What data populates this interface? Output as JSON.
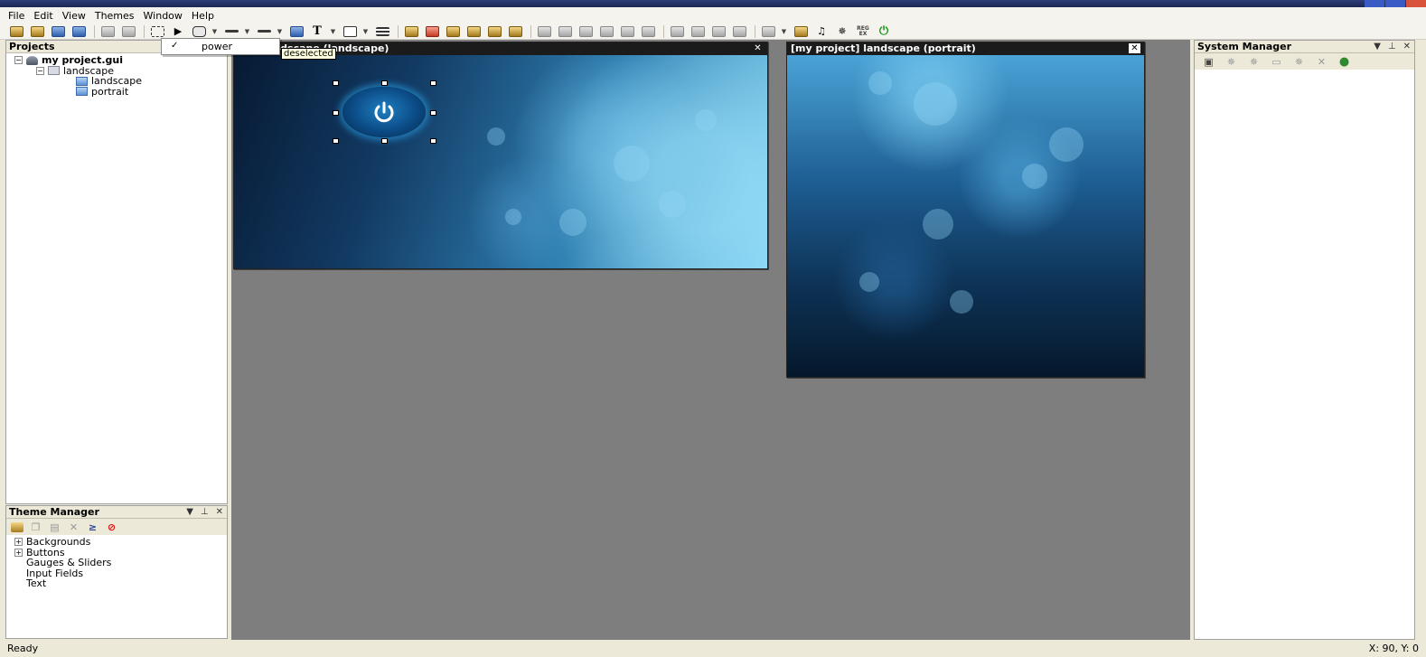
{
  "menu": [
    "File",
    "Edit",
    "View",
    "Themes",
    "Window",
    "Help"
  ],
  "toolbar_icons": [
    "open-project-icon",
    "open-icon",
    "save-icon",
    "save-all-icon",
    "properties-icon",
    "page-icon",
    "marquee-select-icon",
    "pointer-icon",
    "button-tool-icon",
    "slider-tool-icon",
    "input-tool-icon",
    "image-tool-icon",
    "text-tool-icon",
    "image-button-tool-icon",
    "list-tool-icon",
    "anim-d-icon",
    "anim-a-icon",
    "anim-s-icon",
    "anim-txt-icon",
    "anim-theme-icon",
    "anim-img-icon",
    "align-left-icon",
    "align-center-icon",
    "align-right-icon",
    "align-top-icon",
    "align-middle-icon",
    "align-bottom-icon",
    "same-width-icon",
    "same-height-icon",
    "space-vertical-icon",
    "space-horizontal-icon",
    "plugin-icon",
    "theme-edit-icon",
    "music-icon",
    "gear-icon",
    "regex-icon",
    "power-icon"
  ],
  "toolbar_labels": {
    "text_tool": "T",
    "regex": "REG EX"
  },
  "projects_panel": {
    "title": "Projects",
    "tree": {
      "root": "my project.gui",
      "folder": "landscape",
      "pages": [
        "landscape",
        "portrait"
      ]
    }
  },
  "theme_manager": {
    "title": "Theme Manager",
    "items": [
      {
        "label": "Backgrounds",
        "expandable": true
      },
      {
        "label": "Buttons",
        "expandable": true
      },
      {
        "label": "Gauges & Sliders",
        "expandable": false
      },
      {
        "label": "Input Fields",
        "expandable": false
      },
      {
        "label": "Text",
        "expandable": false
      }
    ]
  },
  "system_manager": {
    "title": "System Manager"
  },
  "designers": {
    "landscape_title": "ect] landscape (landscape)",
    "portrait_title": "[my project] landscape (portrait)",
    "close_glyph": "✕"
  },
  "dropdown": {
    "check": "✓",
    "item": "power"
  },
  "tooltip": "deselected",
  "statusbar": {
    "status": "Ready",
    "coords": "X: 90, Y: 0"
  },
  "colors": {
    "workspace": "#7e7e7e",
    "chrome": "#ece9d8",
    "accent_power": "#1f9a1f"
  }
}
